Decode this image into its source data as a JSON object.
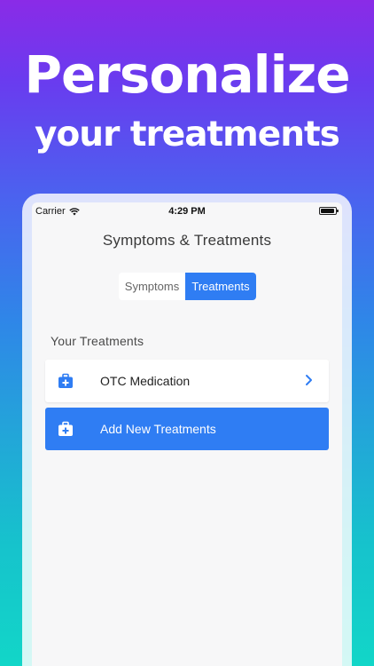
{
  "headline": {
    "line1": "Personalize",
    "line2": "your treatments"
  },
  "status_bar": {
    "carrier": "Carrier",
    "time": "4:29 PM"
  },
  "nav": {
    "title": "Symptoms & Treatments"
  },
  "segments": {
    "symptoms": "Symptoms",
    "treatments": "Treatments",
    "selected": "Treatments"
  },
  "section": {
    "title": "Your Treatments"
  },
  "treatments": [
    {
      "label": "OTC Medication",
      "icon": "medical-kit-icon"
    }
  ],
  "add_button": {
    "label": "Add New Treatments",
    "icon": "medical-kit-icon"
  },
  "colors": {
    "accent": "#2f7df3",
    "background": "#f7f7f8"
  }
}
